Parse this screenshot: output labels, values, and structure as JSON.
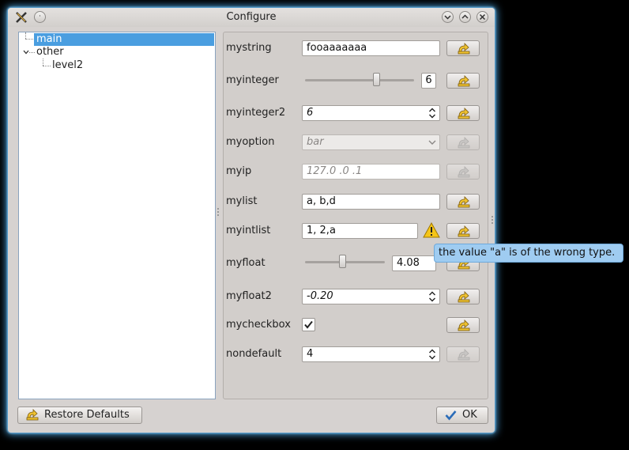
{
  "window": {
    "title": "Configure",
    "accent_color": "#4aa3df"
  },
  "tree": {
    "items": [
      {
        "label": "main",
        "selected": true
      },
      {
        "label": "other",
        "expanded": true
      },
      {
        "label": "level2"
      }
    ]
  },
  "settings": {
    "mystring": {
      "label": "mystring",
      "value": "fooaaaaaaa"
    },
    "myinteger": {
      "label": "myinteger",
      "value": "6",
      "slider_fraction": 0.65
    },
    "myinteger2": {
      "label": "myinteger2",
      "value": "6"
    },
    "myoption": {
      "label": "myoption",
      "value": "bar"
    },
    "myip": {
      "label": "myip",
      "value": "127.0  .0  .1"
    },
    "mylist": {
      "label": "mylist",
      "value": "a, b,d"
    },
    "myintlist": {
      "label": "myintlist",
      "value": "1, 2,a",
      "warning_icon": "warning-triangle-icon"
    },
    "myfloat": {
      "label": "myfloat",
      "value": "4.08",
      "slider_fraction": 0.45
    },
    "myfloat2": {
      "label": "myfloat2",
      "value": "-0.20"
    },
    "mycheckbox": {
      "label": "mycheckbox",
      "checked": true
    },
    "nondefault": {
      "label": "nondefault",
      "value": "4"
    }
  },
  "tooltip": {
    "text": "the value \"a\" is of the wrong type."
  },
  "footer": {
    "restore_label": "Restore Defaults",
    "ok_label": "OK"
  }
}
